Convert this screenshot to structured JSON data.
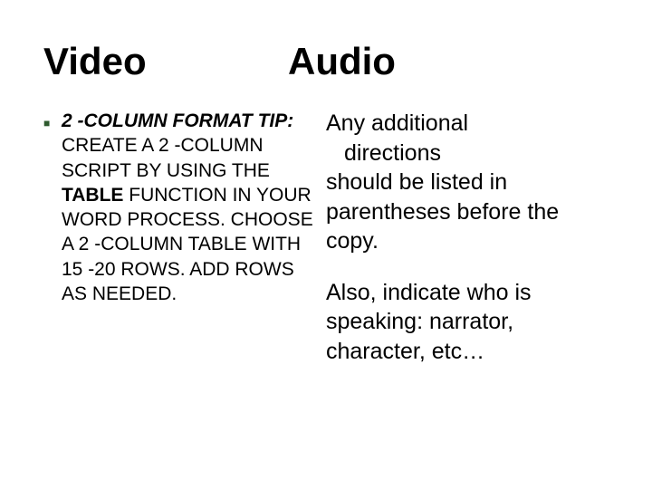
{
  "headings": {
    "left": "Video",
    "right": "Audio"
  },
  "left": {
    "bullet": "■",
    "lead_italic_bold": "2 -COLUMN FORMAT TIP:",
    "body_pre": " CREATE A 2 -COLUMN SCRIPT BY USING THE ",
    "body_bold": "TABLE",
    "body_post": " FUNCTION IN YOUR WORD PROCESS. CHOOSE A 2 -COLUMN TABLE WITH 15 -20 ROWS.  ADD ROWS AS NEEDED."
  },
  "right": {
    "p1_line1": "Any additional ",
    "p1_line2_indent": "directions",
    "p1_rest": "should be listed in parentheses before the copy.",
    "p2": "Also, indicate who is speaking: narrator, character, etc…"
  }
}
